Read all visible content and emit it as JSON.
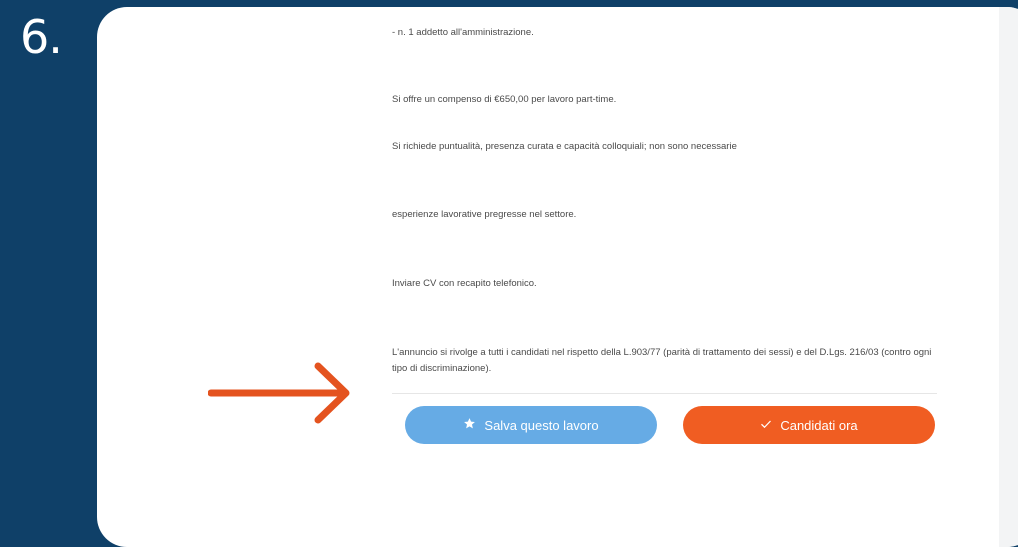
{
  "step": {
    "number": "6."
  },
  "job_text": {
    "lines": [
      "- n. 1 addetto all'amministrazione.",
      "Si offre un compenso di €650,00 per lavoro part-time.",
      "Si richiede puntualità, presenza curata e capacità colloquiali; non sono necessarie",
      "esperienze lavorative pregresse nel settore.",
      "Inviare CV con recapito telefonico."
    ],
    "notice": "L'annuncio si rivolge a tutti i candidati nel rispetto della L.903/77 (parità di trattamento dei sessi) e del D.Lgs. 216/03 (contro ogni tipo di discriminazione)."
  },
  "actions": {
    "save_label": "Salva questo lavoro",
    "save_icon": "star-icon",
    "apply_label": "Candidati ora",
    "apply_icon": "checkmark-icon"
  },
  "colors": {
    "background": "#0f4068",
    "save_button": "#66abe5",
    "apply_button": "#f05d22",
    "arrow": "#e4531f"
  }
}
